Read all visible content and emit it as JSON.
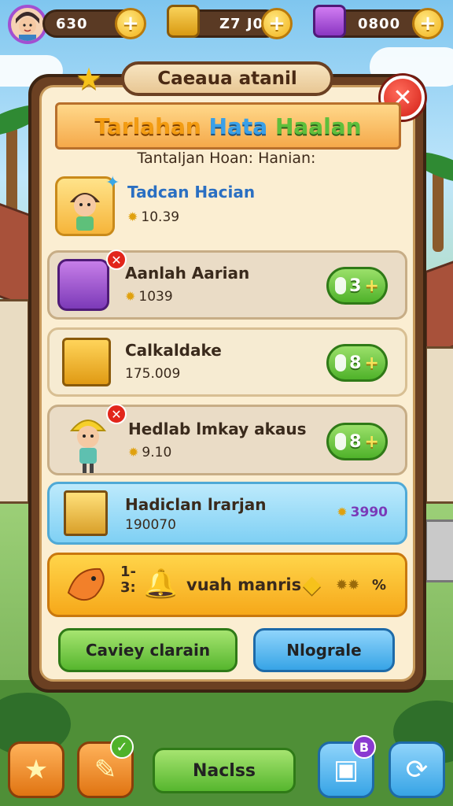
{
  "resources": {
    "coins": "630",
    "gold": "Z7 J0",
    "gems": "0800",
    "plus_glyph": "+"
  },
  "panel": {
    "header_title": "Caeaua atanil",
    "banner": [
      "Tarlahan",
      "Hata",
      "Haalan"
    ],
    "subtitle": "Tantaljan Hoan: Hanian:",
    "close_glyph": "✕"
  },
  "quests": [
    {
      "name": "Tadcan Hacian",
      "value": "10.39",
      "icon": "child-character-icon",
      "claim": ""
    },
    {
      "name": "Aanlah Aarian",
      "value": "1039",
      "icon": "magic-book-icon",
      "claim": "3"
    },
    {
      "name": "Calkaldake",
      "value": "175.009",
      "icon": "gold-chest-icon",
      "claim": "8"
    },
    {
      "name": "Hedlab lmkay akaus",
      "value": "9.10",
      "icon": "cat-hat-character-icon",
      "claim": "8"
    },
    {
      "name": "Hadiclan lrarjan",
      "value": "190070",
      "icon": "treasure-stack-icon",
      "reward": "3990"
    }
  ],
  "promo": {
    "left_text": "1-\n3:",
    "text": "vuah manris",
    "right_text": "%"
  },
  "buttons": {
    "left": "Caviey clarain",
    "right": "Nlograle",
    "bottom_center": "Naclss"
  },
  "bottom_nav": {
    "badge": "B",
    "check": "✓"
  },
  "colors": {
    "accent_green": "#4fb22a",
    "accent_blue": "#37a4e6",
    "panel_brown": "#6b4022",
    "close_red": "#d31f16"
  }
}
